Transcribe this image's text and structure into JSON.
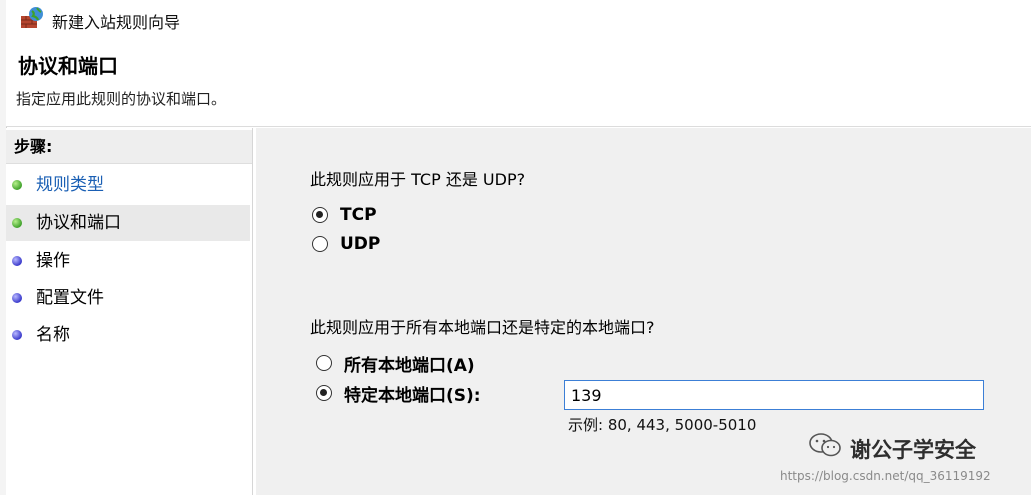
{
  "window": {
    "title": "新建入站规则向导"
  },
  "header": {
    "page_title": "协议和端口",
    "subtitle": "指定应用此规则的协议和端口。"
  },
  "steps": {
    "heading": "步骤:",
    "items": [
      {
        "label": "规则类型",
        "state": "done-link",
        "dot": "green"
      },
      {
        "label": "协议和端口",
        "state": "current",
        "dot": "green"
      },
      {
        "label": "操作",
        "state": "pending",
        "dot": "blue"
      },
      {
        "label": "配置文件",
        "state": "pending",
        "dot": "blue"
      },
      {
        "label": "名称",
        "state": "pending",
        "dot": "blue"
      }
    ]
  },
  "protocol": {
    "question": "此规则应用于 TCP 还是 UDP?",
    "options": [
      {
        "label": "TCP",
        "checked": true
      },
      {
        "label": "UDP",
        "checked": false
      }
    ]
  },
  "ports": {
    "question": "此规则应用于所有本地端口还是特定的本地端口?",
    "options": [
      {
        "label": "所有本地端口(A)",
        "checked": false
      },
      {
        "label": "特定本地端口(S):",
        "checked": true
      }
    ],
    "value": "139",
    "example": "示例: 80, 443, 5000-5010"
  },
  "watermark": {
    "text": "谢公子学安全",
    "url": "https://blog.csdn.net/qq_36119192"
  },
  "colors": {
    "link": "#1a5fb4",
    "content_bg": "#f0f0f0",
    "input_border": "#3c7fd6",
    "step_done_dot": "#3fa12a",
    "step_pending_dot": "#3a3acb"
  }
}
